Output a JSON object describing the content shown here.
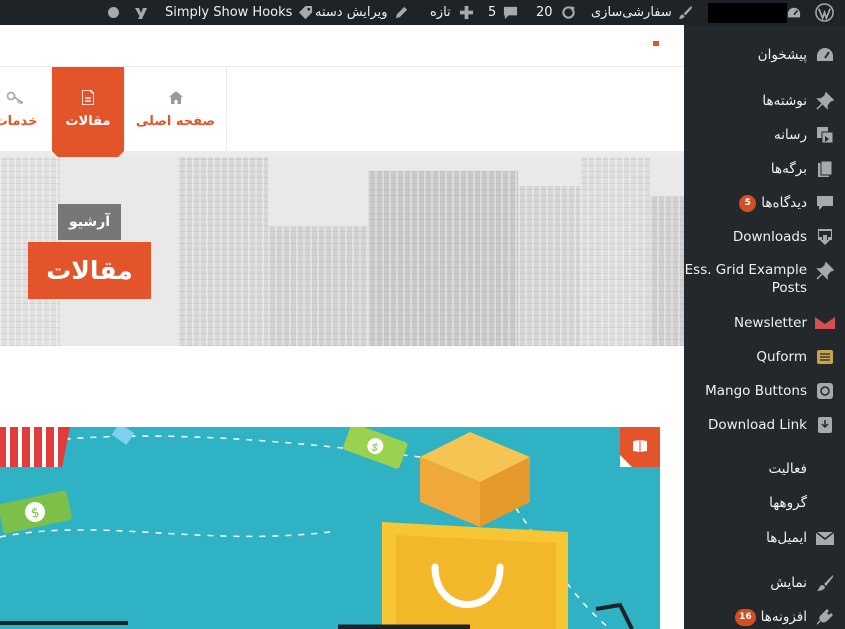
{
  "admin_bar": {
    "customize": "سفارشی‌سازی",
    "updates_count": "20",
    "comments_count": "5",
    "new_label": "تازه",
    "edit_category": "ویرایش دسته",
    "simply_show_hooks": "Simply Show Hooks"
  },
  "sidebar": {
    "dashboard": "پیشخوان",
    "posts": "نوشته‌ها",
    "media": "رسانه",
    "pages": "برگه‌ها",
    "comments": "دیدگاه‌ها",
    "comments_badge": "5",
    "downloads": "Downloads",
    "ess_grid_line1": "Ess. Grid Example",
    "ess_grid_line2": "Posts",
    "newsletter": "Newsletter",
    "quform": "Quform",
    "mango_buttons": "Mango Buttons",
    "download_link": "Download Link",
    "activity": "فعالیت",
    "groups": "گروهها",
    "emails": "ایمیل‌ها",
    "appearance": "نمایش",
    "plugins": "افزونه‌ها",
    "plugins_badge": "16"
  },
  "site_nav": {
    "home": "صفحه اصلی",
    "articles": "مقالات",
    "services": "خدمات"
  },
  "hero": {
    "archive_label": "آرشیو",
    "title": "مقالات"
  },
  "colors": {
    "accent": "#e4542a",
    "admin_bar_bg": "#1d2327",
    "sidebar_bg": "#23282d",
    "post_image_bg": "#2fb2c3"
  },
  "icons": {
    "wp_logo": "wordpress-icon",
    "dashboard": "dashboard-gauge-icon",
    "posts": "thumbtack-icon",
    "media": "media-icon",
    "pages": "pages-icon",
    "comments": "comment-bubble-icon",
    "downloads": "download-icon",
    "newsletter": "envelope-icon",
    "appearance": "brush-icon",
    "plugins": "plug-icon"
  }
}
